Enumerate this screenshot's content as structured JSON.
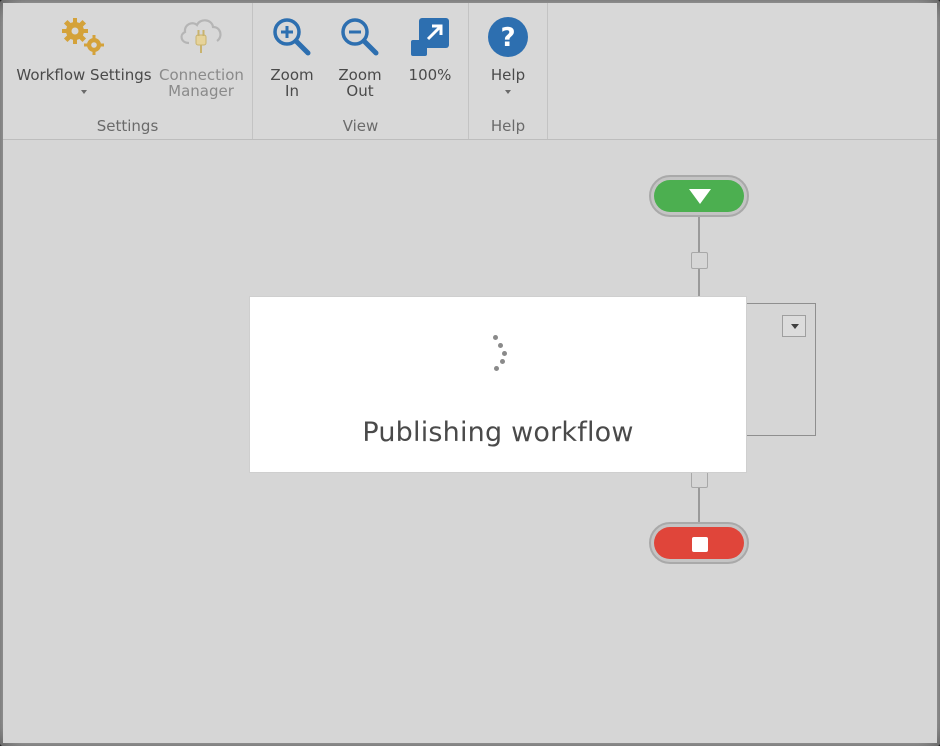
{
  "ribbon": {
    "groups": [
      {
        "label": "Settings"
      },
      {
        "label": "View"
      },
      {
        "label": "Help"
      }
    ],
    "buttons": {
      "workflow_settings": "Workflow Settings",
      "connection_manager_line1": "Connection",
      "connection_manager_line2": "Manager",
      "zoom_in_line1": "Zoom",
      "zoom_in_line2": "In",
      "zoom_out_line1": "Zoom",
      "zoom_out_line2": "Out",
      "zoom_reset": "100%",
      "help": "Help"
    },
    "icons": {
      "workflow_settings": "gears-icon",
      "connection_manager": "cloud-plug-icon",
      "zoom_in": "zoom-in-icon",
      "zoom_out": "zoom-out-icon",
      "zoom_reset": "fit-100-icon",
      "help": "question-icon"
    }
  },
  "modal": {
    "message": "Publishing workflow"
  },
  "colors": {
    "start": "#4caf50",
    "stop": "#e0453a",
    "accent_blue": "#2d6fb0",
    "gear_gold": "#d4a23a"
  }
}
